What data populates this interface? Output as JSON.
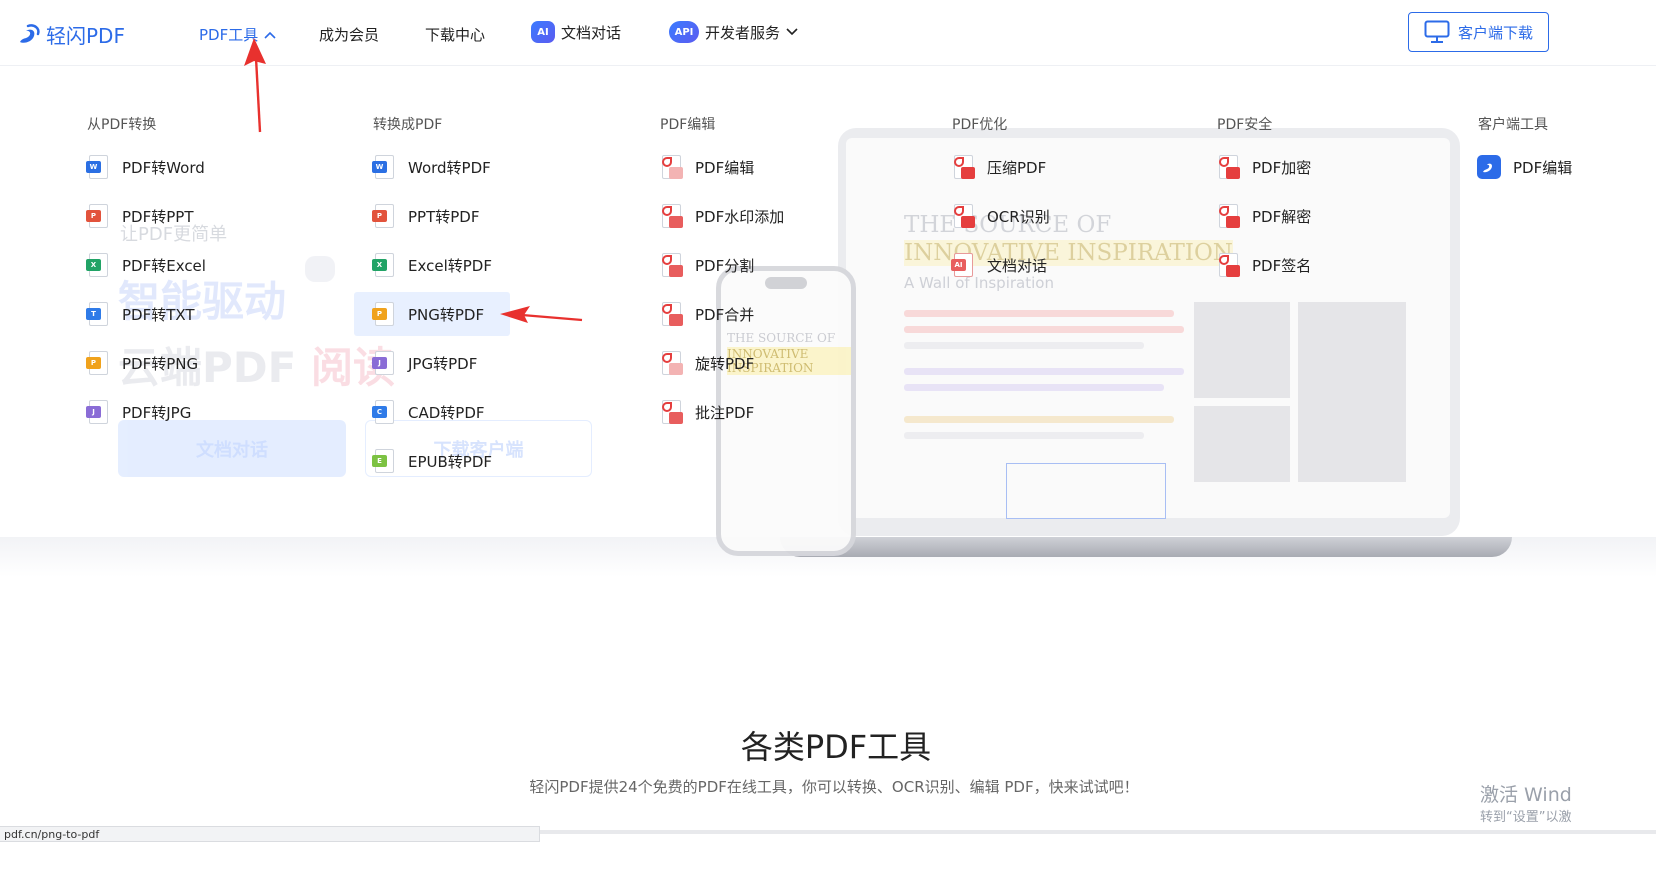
{
  "header": {
    "logo_text": "轻闪PDF",
    "nav": [
      {
        "label": "PDF工具",
        "active": true
      },
      {
        "label": "成为会员"
      },
      {
        "label": "下载中心"
      },
      {
        "label": "文档对话",
        "badge": "AI"
      },
      {
        "label": "开发者服务",
        "badge": "API"
      }
    ],
    "client_download": "客户端下载"
  },
  "menu": {
    "columns": [
      {
        "title": "从PDF转换",
        "items": [
          "PDF转Word",
          "PDF转PPT",
          "PDF转Excel",
          "PDF转TXT",
          "PDF转PNG",
          "PDF转JPG"
        ]
      },
      {
        "title": "转换成PDF",
        "items": [
          "Word转PDF",
          "PPT转PDF",
          "Excel转PDF",
          "PNG转PDF",
          "JPG转PDF",
          "CAD转PDF",
          "EPUB转PDF"
        ]
      },
      {
        "title": "PDF编辑",
        "items": [
          "PDF编辑",
          "PDF水印添加",
          "PDF分割",
          "PDF合并",
          "旋转PDF",
          "批注PDF"
        ]
      },
      {
        "title": "PDF优化",
        "items": [
          "压缩PDF",
          "OCR识别",
          "文档对话"
        ]
      },
      {
        "title": "PDF安全",
        "items": [
          "PDF加密",
          "PDF解密",
          "PDF签名"
        ]
      },
      {
        "title": "客户端工具",
        "items": [
          "PDF编辑"
        ]
      }
    ],
    "highlighted_item": "PNG转PDF"
  },
  "hero_background": {
    "tagline": "让PDF更简单",
    "headline1": "智能驱动",
    "headline2_a": "云端PDF",
    "headline2_b": "阅读",
    "chat_button": "文档对话",
    "download_button": "下载客户端"
  },
  "illustration": {
    "laptop_title1": "THE SOURCE OF",
    "laptop_title2": "INNOVATIVE INSPIRATION",
    "laptop_sub": "A Wall of Inspiration",
    "phone_title1": "THE SOURCE OF",
    "phone_title2": "INNOVATIVE INSPIRATION"
  },
  "section": {
    "title": "各类PDF工具",
    "subtitle": "轻闪PDF提供24个免费的PDF在线工具，你可以转换、OCR识别、编辑 PDF，快来试试吧！"
  },
  "system": {
    "watermark_line1": "激活 Wind",
    "watermark_line2": "转到“设置”以激",
    "status_url": "pdf.cn/png-to-pdf"
  },
  "colors": {
    "brand": "#2c6be8",
    "word": "#2b6fe3",
    "ppt": "#e2533c",
    "excel": "#21a366",
    "txt": "#2f7be8",
    "png": "#f0a21c",
    "jpg": "#8a6cd6",
    "pdf_red": "#e53e3e",
    "arrow_red": "#e8312e"
  }
}
